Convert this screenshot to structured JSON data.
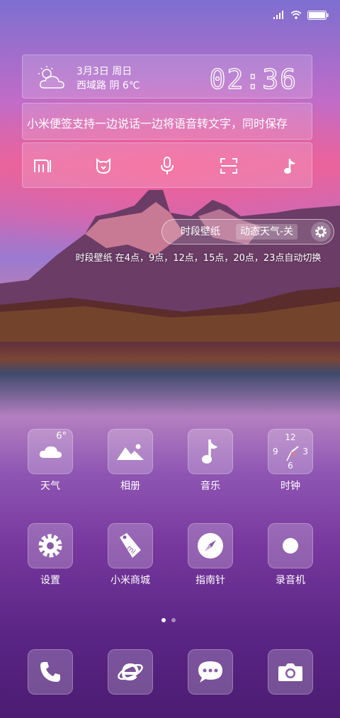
{
  "weather": {
    "date": "3月3日  周日",
    "location_weather": "西域路 阴 6℃",
    "time": "02:36"
  },
  "note": {
    "text": "小米便签支持一边说话一边将语音转文字，同时保存"
  },
  "wallpaper": {
    "option1": "时段壁纸",
    "option2": "动态天气-关",
    "info": "时段壁纸 在4点，9点，12点，15点，20点，23点自动切换"
  },
  "apps_row1": [
    {
      "label": "天气",
      "icon": "weather-cloud-icon",
      "badge": "6°"
    },
    {
      "label": "相册",
      "icon": "gallery-icon"
    },
    {
      "label": "音乐",
      "icon": "music-note-icon"
    },
    {
      "label": "时钟",
      "icon": "clock-icon"
    }
  ],
  "clock_face": {
    "n12": "12",
    "n3": "3",
    "n6": "6",
    "n9": "9"
  },
  "apps_row2": [
    {
      "label": "设置",
      "icon": "settings-gear-icon"
    },
    {
      "label": "小米商城",
      "icon": "mi-store-tag-icon"
    },
    {
      "label": "指南针",
      "icon": "compass-icon"
    },
    {
      "label": "录音机",
      "icon": "recorder-icon"
    }
  ],
  "dock": [
    {
      "icon": "phone-icon"
    },
    {
      "icon": "browser-icon"
    },
    {
      "icon": "messages-icon"
    },
    {
      "icon": "camera-icon"
    }
  ],
  "status_bar": {
    "icons": [
      "signal-icon",
      "wifi-icon",
      "battery-icon"
    ]
  }
}
